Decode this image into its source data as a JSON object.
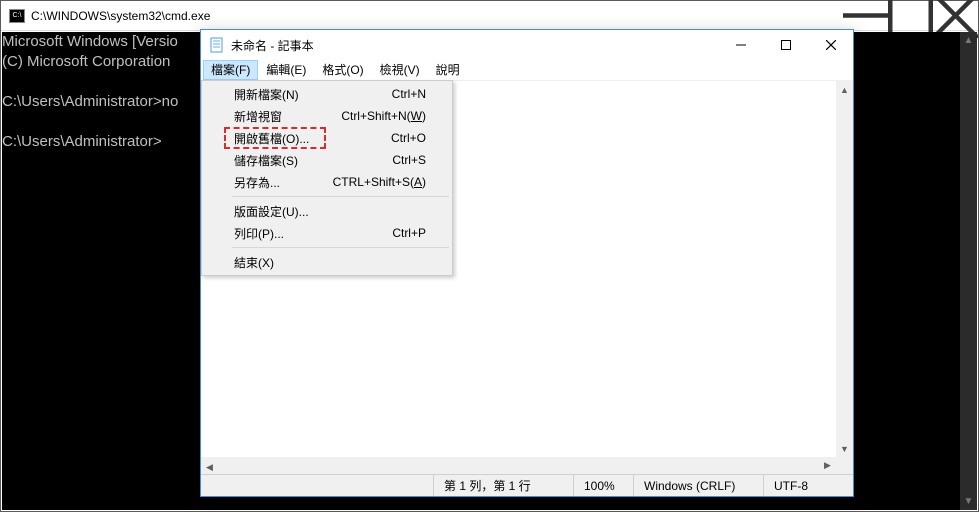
{
  "cmd": {
    "title": "C:\\WINDOWS\\system32\\cmd.exe",
    "icon_label": "C:\\",
    "lines": {
      "l0": "Microsoft Windows [Versio",
      "l1": "(C) Microsoft Corporation",
      "l2": "",
      "l3": "C:\\Users\\Administrator>no",
      "l4": "",
      "l5": "C:\\Users\\Administrator>"
    }
  },
  "notepad": {
    "title": "未命名 - 記事本",
    "menubar": {
      "file": "檔案(F)",
      "edit": "編輯(E)",
      "format": "格式(O)",
      "view": "檢視(V)",
      "help": "說明"
    },
    "status": {
      "position": "第 1 列，第 1 行",
      "zoom": "100%",
      "lineending": "Windows (CRLF)",
      "encoding": "UTF-8"
    }
  },
  "filemenu": {
    "new": {
      "label": "開新檔案(N)",
      "shortcut": "Ctrl+N"
    },
    "newwindow": {
      "label_pre": "新增視窗",
      "shortcut_pre": "Ctrl+Shift+N(",
      "shortcut_u": "W",
      "shortcut_post": ")"
    },
    "open": {
      "label": "開啟舊檔(O)...",
      "shortcut": "Ctrl+O"
    },
    "save": {
      "label": "儲存檔案(S)",
      "shortcut": "Ctrl+S"
    },
    "saveas": {
      "label": "另存為...",
      "shortcut_pre": "CTRL+Shift+S(",
      "shortcut_u": "A",
      "shortcut_post": ")"
    },
    "pagesetup": {
      "label": "版面設定(U)..."
    },
    "print": {
      "label": "列印(P)...",
      "shortcut": "Ctrl+P"
    },
    "exit": {
      "label": "結束(X)"
    }
  }
}
